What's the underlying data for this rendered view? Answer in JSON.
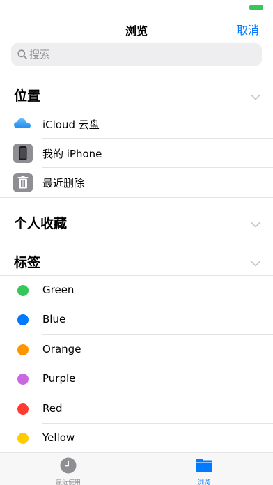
{
  "nav": {
    "title": "浏览",
    "cancel_label": "取消"
  },
  "search": {
    "placeholder": "搜索"
  },
  "locations": {
    "title": "位置",
    "items": [
      {
        "label": "iCloud 云盘",
        "icon": "icloud-icon"
      },
      {
        "label": "我的 iPhone",
        "icon": "iphone-icon"
      },
      {
        "label": "最近删除",
        "icon": "trash-icon"
      }
    ]
  },
  "favorites": {
    "title": "个人收藏"
  },
  "tags": {
    "title": "标签",
    "items": [
      {
        "label": "Green",
        "color": "#34c759"
      },
      {
        "label": "Blue",
        "color": "#007aff"
      },
      {
        "label": "Orange",
        "color": "#ff9500"
      },
      {
        "label": "Purple",
        "color": "#c969e0"
      },
      {
        "label": "Red",
        "color": "#ff3b30"
      },
      {
        "label": "Yellow",
        "color": "#ffcc00"
      }
    ]
  },
  "tabbar": {
    "recents_label": "最近使用",
    "browse_label": "浏览",
    "active_color": "#007aff",
    "inactive_color": "#8e8e93"
  }
}
